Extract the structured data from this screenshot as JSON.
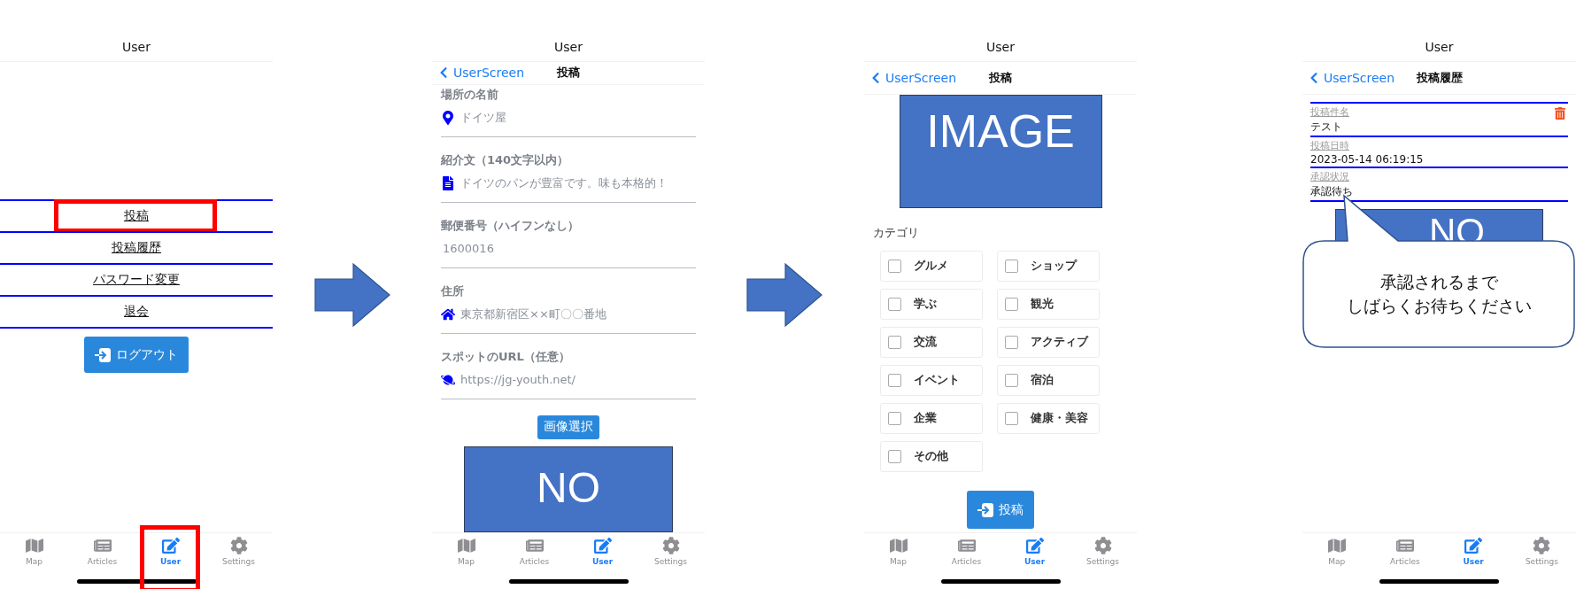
{
  "screens": [
    {
      "kind": "menu",
      "header": "User",
      "arrow_after": true,
      "menu": [
        {
          "label": "投稿",
          "highlighted": true
        },
        {
          "label": "投稿履歴",
          "highlighted": false
        },
        {
          "label": "パスワード変更",
          "highlighted": false
        },
        {
          "label": "退会",
          "highlighted": false
        }
      ],
      "logout_button": "ログアウト",
      "tabs": [
        {
          "label": "Map",
          "selected": false,
          "highlighted": false
        },
        {
          "label": "Articles",
          "selected": false,
          "highlighted": false
        },
        {
          "label": "User",
          "selected": true,
          "highlighted": true
        },
        {
          "label": "Settings",
          "selected": false,
          "highlighted": false
        }
      ]
    },
    {
      "kind": "form",
      "header": "User",
      "arrow_after": true,
      "nav": {
        "back": "UserScreen",
        "title": "投稿"
      },
      "fields": [
        {
          "label": "場所の名前",
          "placeholder": "ドイツ屋"
        },
        {
          "label": "紹介文（140文字以内）",
          "placeholder": "ドイツのパンが豊富です。味も本格的！"
        },
        {
          "label": "郵便番号（ハイフンなし）",
          "placeholder": "1600016"
        },
        {
          "label": "住所",
          "placeholder": "東京都新宿区××町〇〇番地"
        },
        {
          "label": "スポットのURL（任意）",
          "placeholder": "https://jg-youth.net/"
        }
      ],
      "image_button": "画像選択",
      "image_text": "NO",
      "tabs": [
        {
          "label": "Map",
          "selected": false
        },
        {
          "label": "Articles",
          "selected": false
        },
        {
          "label": "User",
          "selected": true
        },
        {
          "label": "Settings",
          "selected": false
        }
      ]
    },
    {
      "kind": "categories",
      "header": "User",
      "arrow_after": false,
      "nav": {
        "back": "UserScreen",
        "title": "投稿"
      },
      "image_text": "IMAGE",
      "section_label": "カテゴリ",
      "categories": [
        {
          "label": "グルメ",
          "checked": false
        },
        {
          "label": "ショップ",
          "checked": false
        },
        {
          "label": "学ぶ",
          "checked": false
        },
        {
          "label": "観光",
          "checked": false
        },
        {
          "label": "交流",
          "checked": false
        },
        {
          "label": "アクティブ",
          "checked": false
        },
        {
          "label": "イベント",
          "checked": false
        },
        {
          "label": "宿泊",
          "checked": false
        },
        {
          "label": "企業",
          "checked": false
        },
        {
          "label": "健康・美容",
          "checked": false
        },
        {
          "label": "その他",
          "checked": false
        }
      ],
      "submit_button": "投稿",
      "tabs": [
        {
          "label": "Map",
          "selected": false
        },
        {
          "label": "Articles",
          "selected": false
        },
        {
          "label": "User",
          "selected": true
        },
        {
          "label": "Settings",
          "selected": false
        }
      ]
    },
    {
      "kind": "history",
      "header": "User",
      "nav": {
        "back": "UserScreen",
        "title": "投稿履歴"
      },
      "record": [
        {
          "label": "投稿件名",
          "value": "テスト"
        },
        {
          "label": "投稿日時",
          "value": "2023-05-14 06:19:15"
        },
        {
          "label": "承認状況",
          "value": "承認待ち"
        }
      ],
      "image_text": "NO",
      "callout": [
        "承認されるまで",
        "しばらくお待ちください"
      ],
      "tabs": [
        {
          "label": "Map",
          "selected": false
        },
        {
          "label": "Articles",
          "selected": false
        },
        {
          "label": "User",
          "selected": true
        },
        {
          "label": "Settings",
          "selected": false
        }
      ]
    }
  ]
}
